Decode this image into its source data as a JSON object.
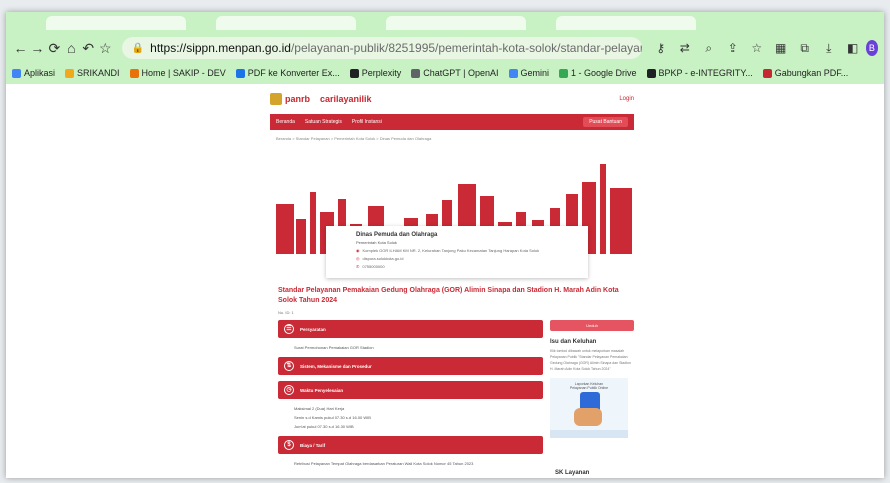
{
  "browser": {
    "url_host": "https://sippn.menpan.go.id",
    "url_path": "/pelayanan-publik/8251995/pemerintah-kota-solok/standar-pelayanan-pemakai...",
    "bookmarks": [
      {
        "label": "Aplikasi",
        "color": "#4285f4"
      },
      {
        "label": "SRIKANDI",
        "color": "#f2a81d"
      },
      {
        "label": "Home | SAKIP - DEV",
        "color": "#e8710a"
      },
      {
        "label": "PDF ke Konverter Ex...",
        "color": "#1a73e8"
      },
      {
        "label": "Perplexity",
        "color": "#202124"
      },
      {
        "label": "ChatGPT | OpenAI",
        "color": "#5f6368"
      },
      {
        "label": "Gemini",
        "color": "#4285f4"
      },
      {
        "label": "1 - Google Drive",
        "color": "#34a853"
      },
      {
        "label": "BPKP - e-INTEGRITY...",
        "color": "#202124"
      },
      {
        "label": "Gabungkan PDF...",
        "color": "#c5282f"
      }
    ],
    "profile_initial": "B"
  },
  "site": {
    "logo_text": "panrb",
    "cari_text": "carilayanilik",
    "login": "Login",
    "nav": [
      "Beranda",
      "Satuan Strategis",
      "Profil Instansi"
    ],
    "nav_right": "Pusat Bantuan",
    "breadcrumb": "Beranda > Standar Pelayanan > Pemerintah Kota Solok > Dinas Pemuda dan Olahraga"
  },
  "agency": {
    "name": "Dinas Pemuda dan Olahraga",
    "parent": "Pemerintah Kota Solok",
    "address": "Komplek GOR ILHAM KM NR. 2, Kelurahan Tanjung Paku Kecamatan Tanjung Harapan Kota Solok",
    "email": "dispora.solokkota.go.id",
    "phone": "0755000000"
  },
  "page": {
    "title": "Standar Pelayanan Pemakaian Gedung Olahraga (GOR) Alimin Sinapa dan Stadion H. Marah Adin Kota Solok Tahun 2024",
    "counter": "No. ID: 1",
    "sections": [
      {
        "title": "Persyaratan",
        "icon": "clipboard-icon",
        "items": [
          "Surat Permohonan Pemakaian GOR Stadion"
        ]
      },
      {
        "title": "Sistem, Mekanisme dan Prosedur",
        "icon": "flow-icon",
        "items": []
      },
      {
        "title": "Waktu Penyelesaian",
        "icon": "clock-icon",
        "items": [
          "Maksimal 2 (Dua) Hari Kerja",
          "Senin s.d Kamis pukul 07.30 s.d 16.00 WIB",
          "Jum'at pukul 07.30 s.d 16.30 WIB"
        ]
      },
      {
        "title": "Biaya / Tarif",
        "icon": "coin-icon",
        "items": [
          "Retribusi Pelayanan Tempat Olahraga berdasarkan Peraturan Wali Kota Solok Nomor 45 Tahun 2023"
        ]
      }
    ]
  },
  "sidebar": {
    "button": "Unduh",
    "title": "Isu dan Keluhan",
    "text": "Klik tombol dibawah untuk melaporkan masalah Pelayanan Publik \"Standar Pelayanan Pemakaian Gedung Olahraga (GOR) Alimin Sinapa dan Stadion H. Marah Adin Kota Solok Tahun 2024\"",
    "card_label": "Laporkan Keluhan Pelayanan Publik Online",
    "sk_title": "SK Layanan"
  },
  "colors": {
    "accent": "#c92a35",
    "browser_bg": "#c9f2c4"
  }
}
